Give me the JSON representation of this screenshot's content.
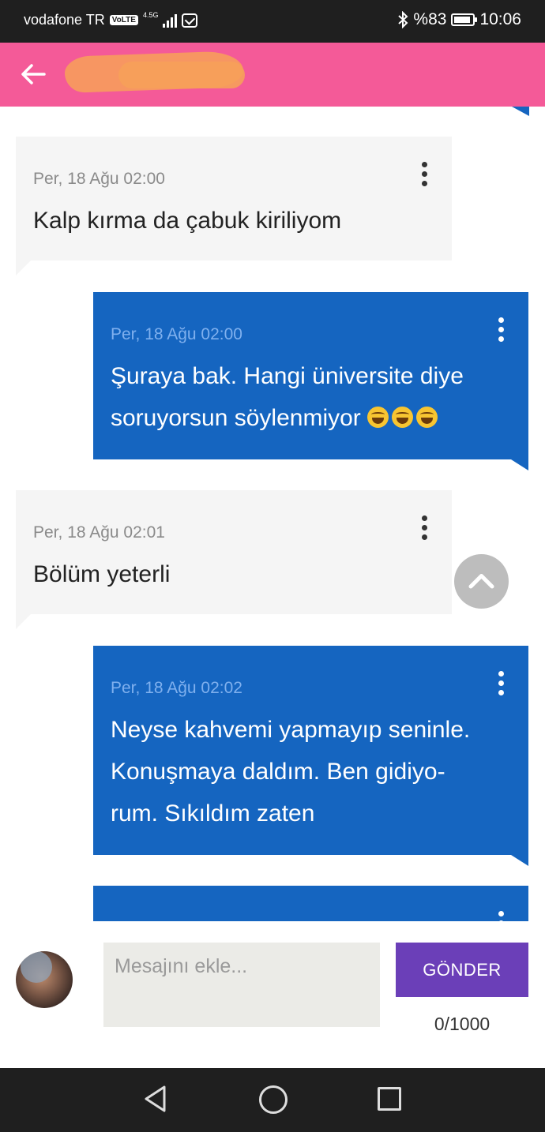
{
  "status_bar": {
    "carrier": "vodafone TR",
    "volte": "VoLTE",
    "network": "4.5G",
    "battery_percent": "%83",
    "time": "10:06"
  },
  "app_bar": {
    "back_icon": "arrow-left-icon",
    "title_redacted": true
  },
  "messages": [
    {
      "direction": "incoming",
      "timestamp": "Per, 18 Ağu 02:00",
      "text": "Kalp kırma da çabuk kiriliyom"
    },
    {
      "direction": "outgoing",
      "timestamp": "Per, 18 Ağu 02:00",
      "text_line1": "Şuraya bak. Hangi üniversite diye",
      "text_line2": "soruyorsun söylenmiyor",
      "emojis": [
        "face-with-tears-of-joy",
        "face-with-tears-of-joy",
        "face-with-tears-of-joy"
      ]
    },
    {
      "direction": "incoming",
      "timestamp": "Per, 18 Ağu 02:01",
      "text": "Bölüm yeterli"
    },
    {
      "direction": "outgoing",
      "timestamp": "Per, 18 Ağu 02:02",
      "text_line1": "Neyse kahvemi yapmayıp seninle.",
      "text_line2": "Konuşmaya daldım. Ben gidiyo-",
      "text_line3": "rum. Sıkıldım zaten"
    }
  ],
  "composer": {
    "placeholder": "Mesajını ekle...",
    "value": "",
    "send_label": "GÖNDER",
    "counter": "0/1000"
  },
  "colors": {
    "app_bar": "#f45a98",
    "outgoing_bubble": "#1565c0",
    "incoming_bubble": "#f5f5f5",
    "send_button": "#6b3fb8",
    "status_bar": "#1f1f1f"
  }
}
